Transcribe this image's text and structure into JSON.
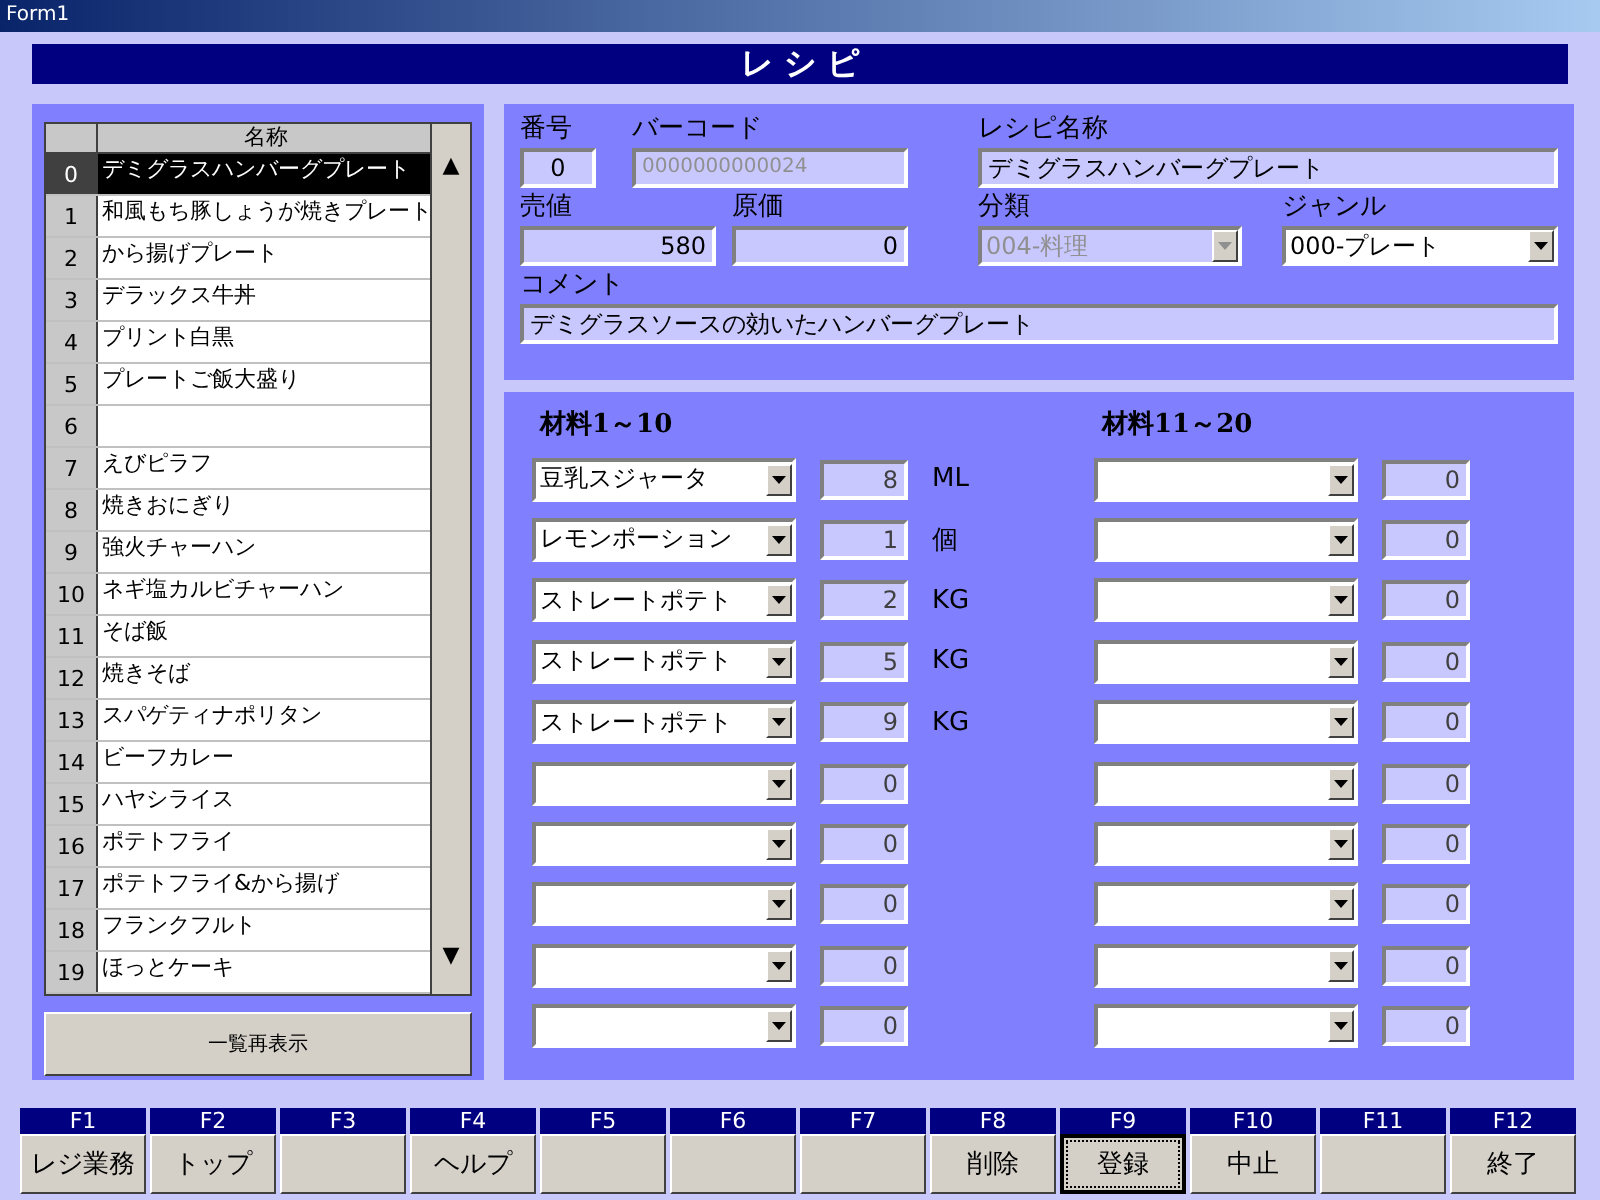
{
  "window": {
    "title": "Form1"
  },
  "header": "レ シ ピ",
  "list": {
    "column": "名称",
    "scroll_up": "▲",
    "scroll_down": "▼",
    "rows": [
      {
        "index": "0",
        "name": "デミグラスハンバーグプレート",
        "selected": true
      },
      {
        "index": "1",
        "name": "和風もち豚しょうが焼きプレート",
        "selected": false
      },
      {
        "index": "2",
        "name": "から揚げプレート",
        "selected": false
      },
      {
        "index": "3",
        "name": "デラックス牛丼",
        "selected": false
      },
      {
        "index": "4",
        "name": "プリント白黒",
        "selected": false
      },
      {
        "index": "5",
        "name": "プレートご飯大盛り",
        "selected": false
      },
      {
        "index": "6",
        "selected": false
      },
      {
        "index": "7",
        "name": "えびピラフ",
        "selected": false
      },
      {
        "index": "8",
        "name": "焼きおにぎり",
        "selected": false
      },
      {
        "index": "9",
        "name": "強火チャーハン",
        "selected": false
      },
      {
        "index": "10",
        "name": "ネギ塩カルビチャーハン",
        "selected": false
      },
      {
        "index": "11",
        "name": "そば飯",
        "selected": false
      },
      {
        "index": "12",
        "name": "焼きそば",
        "selected": false
      },
      {
        "index": "13",
        "name": "スパゲティナポリタン",
        "selected": false
      },
      {
        "index": "14",
        "name": "ビーフカレー",
        "selected": false
      },
      {
        "index": "15",
        "name": "ハヤシライス",
        "selected": false
      },
      {
        "index": "16",
        "name": "ポテトフライ",
        "selected": false
      },
      {
        "index": "17",
        "name": "ポテトフライ&から揚げ",
        "selected": false
      },
      {
        "index": "18",
        "name": "フランクフルト",
        "selected": false
      },
      {
        "index": "19",
        "name": "ほっとケーキ",
        "selected": false
      }
    ],
    "refresh_button": "一覧再表示"
  },
  "detail": {
    "number": {
      "label": "番号",
      "value": "0"
    },
    "barcode": {
      "label": "バーコード",
      "value": "0000000000024",
      "disabled": true
    },
    "recipe_name": {
      "label": "レシピ名称",
      "value": "デミグラスハンバーグプレート"
    },
    "price": {
      "label": "売値",
      "value": "580"
    },
    "cost": {
      "label": "原価",
      "value": "0"
    },
    "category": {
      "label": "分類",
      "value": "004-料理",
      "disabled": true
    },
    "genre": {
      "label": "ジャンル",
      "value": "000-プレート",
      "disabled": false
    },
    "comment": {
      "label": "コメント",
      "value": "デミグラスソースの効いたハンバーグプレート"
    }
  },
  "materials": [
    {
      "heading": "材料1～10",
      "items": [
        {
          "name": "豆乳スジャータ",
          "qty": "8",
          "unit": "ML"
        },
        {
          "name": "レモンポーション",
          "qty": "1",
          "unit": "個"
        },
        {
          "name": "ストレートポテト",
          "qty": "2",
          "unit": "KG"
        },
        {
          "name": "ストレートポテト",
          "qty": "5",
          "unit": "KG"
        },
        {
          "name": "ストレートポテト",
          "qty": "9",
          "unit": "KG"
        },
        {
          "qty": "0"
        },
        {
          "qty": "0"
        },
        {
          "qty": "0"
        },
        {
          "qty": "0"
        },
        {
          "qty": "0"
        }
      ]
    },
    {
      "heading": "材料11～20",
      "items": [
        {
          "qty": "0"
        },
        {
          "qty": "0"
        },
        {
          "qty": "0"
        },
        {
          "qty": "0"
        },
        {
          "qty": "0"
        },
        {
          "qty": "0"
        },
        {
          "qty": "0"
        },
        {
          "qty": "0"
        },
        {
          "qty": "0"
        },
        {
          "qty": "0"
        }
      ]
    }
  ],
  "function_keys": [
    {
      "key": "F1",
      "label": "レジ業務",
      "focused": false
    },
    {
      "key": "F2",
      "label": "トップ",
      "focused": false
    },
    {
      "key": "F3",
      "focused": false
    },
    {
      "key": "F4",
      "label": "ヘルプ",
      "focused": false
    },
    {
      "key": "F5",
      "focused": false
    },
    {
      "key": "F6",
      "focused": false
    },
    {
      "key": "F7",
      "focused": false
    },
    {
      "key": "F8",
      "label": "削除",
      "focused": false
    },
    {
      "key": "F9",
      "label": "登録",
      "focused": true
    },
    {
      "key": "F10",
      "label": "中止",
      "focused": false
    },
    {
      "key": "F11",
      "focused": false
    },
    {
      "key": "F12",
      "label": "終了",
      "focused": false
    }
  ]
}
